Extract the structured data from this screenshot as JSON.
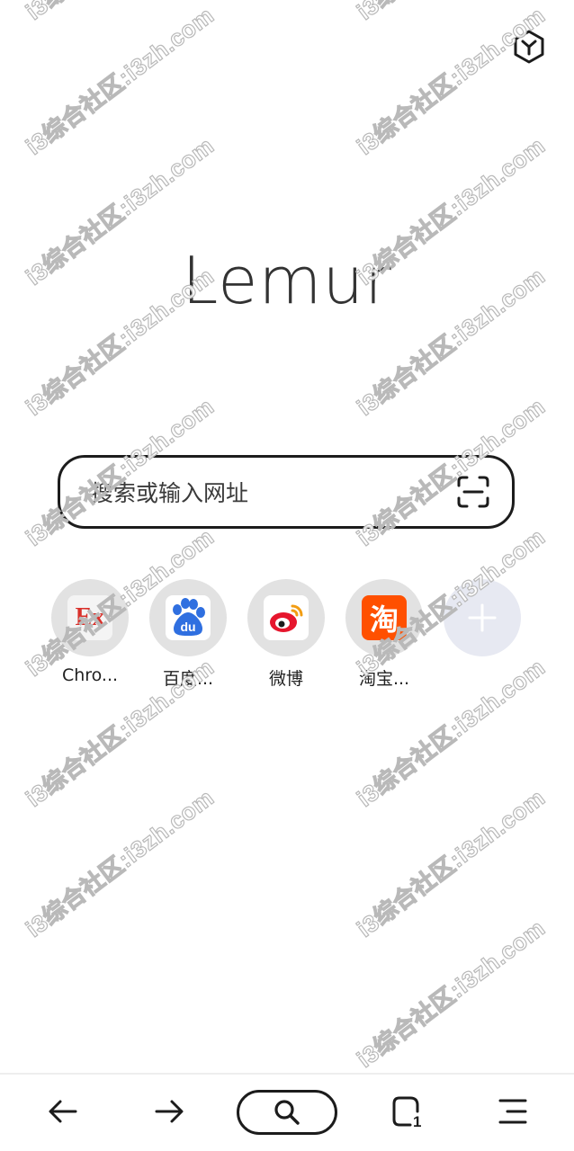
{
  "logo": {
    "text": "Lemur"
  },
  "search": {
    "placeholder": "搜索或输入网址"
  },
  "shortcuts": [
    {
      "label": "Chro...",
      "icon": "extension-ex-icon",
      "tile_text": "Ex",
      "tile_color": "#d9302a"
    },
    {
      "label": "百度...",
      "icon": "baidu-paw-icon",
      "tile_text": "du",
      "tile_color": "#2f6fe0"
    },
    {
      "label": "微博",
      "icon": "weibo-icon",
      "tile_color": "#e6162d"
    },
    {
      "label": "淘宝...",
      "icon": "taobao-icon",
      "tile_text": "淘",
      "tile_color": "#ff5000"
    }
  ],
  "add_shortcut": {
    "icon": "plus-icon"
  },
  "bottom_bar": {
    "tabs_count": "1"
  },
  "watermark": {
    "text": "i3综合社区:i3zh.com"
  },
  "colors": {
    "text": "#333333",
    "border": "#1c1c1c",
    "shortcut_bg": "#e2e2e2",
    "add_bg": "#e7e9f2"
  }
}
